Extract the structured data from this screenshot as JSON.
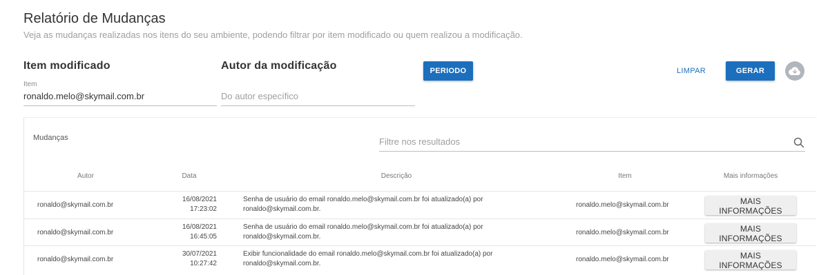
{
  "header": {
    "title": "Relatório de Mudanças",
    "subtitle": "Veja as mudanças realizadas nos itens do seu ambiente, podendo filtrar por item modificado ou quem realizou a modificação."
  },
  "filters": {
    "item_section_title": "Item modificado",
    "item_label": "Item",
    "item_value": "ronaldo.melo@skymail.com.br",
    "author_section_title": "Autor da modificação",
    "author_placeholder": "Do autor específico",
    "period_button": "PERIODO",
    "clear_button": "LIMPAR",
    "generate_button": "GERAR",
    "download_icon": "cloud-download-icon"
  },
  "results": {
    "title": "Mudanças",
    "filter_placeholder": "Filtre nos resultados",
    "columns": [
      "Autor",
      "Data",
      "Descrição",
      "Item",
      "Mais informações"
    ],
    "rows": [
      {
        "autor": "ronaldo@skymail.com.br",
        "date": "16/08/2021",
        "time": "17:23:02",
        "desc_line1": "Senha de usuário do email ronaldo.melo@skymail.com.br foi atualizado(a) por",
        "desc_line2": "ronaldo@skymail.com.br.",
        "item": "ronaldo.melo@skymail.com.br",
        "button": "MAIS INFORMAÇÕES"
      },
      {
        "autor": "ronaldo@skymail.com.br",
        "date": "16/08/2021",
        "time": "16:45:05",
        "desc_line1": "Senha de usuário do email ronaldo.melo@skymail.com.br foi atualizado(a) por",
        "desc_line2": "ronaldo@skymail.com.br.",
        "item": "ronaldo.melo@skymail.com.br",
        "button": "MAIS INFORMAÇÕES"
      },
      {
        "autor": "ronaldo@skymail.com.br",
        "date": "30/07/2021",
        "time": "10:27:42",
        "desc_line1": "Exibir funcionalidade do email ronaldo.melo@skymail.com.br foi atualizado(a) por",
        "desc_line2": "ronaldo@skymail.com.br.",
        "item": "ronaldo.melo@skymail.com.br",
        "button": "MAIS INFORMAÇÕES"
      }
    ]
  },
  "colors": {
    "primary": "#1b6fbd",
    "muted": "#9e9e9e",
    "button_grey": "#efefef"
  }
}
